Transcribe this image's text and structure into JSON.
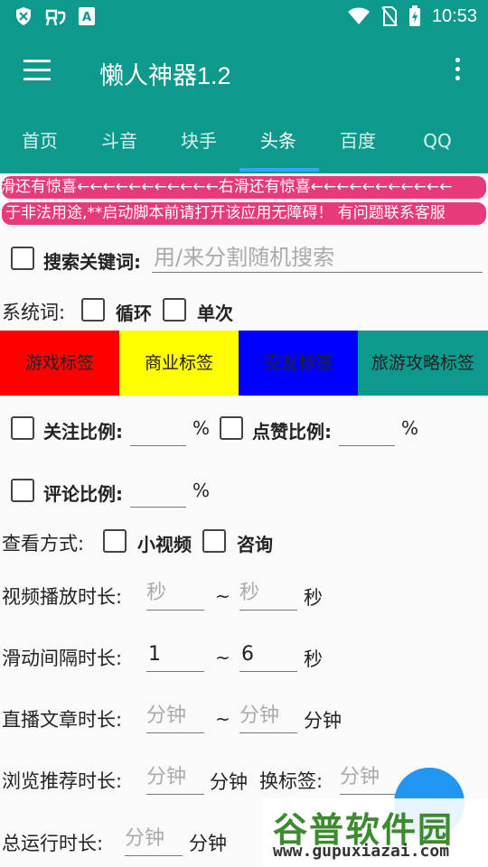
{
  "status_bar": {
    "time": "10:53",
    "left_icons": [
      "shield-icon",
      "bug-icon",
      "font-icon"
    ],
    "right_icons": [
      "wifi-icon",
      "no-sim-icon",
      "battery-charging-icon"
    ]
  },
  "app_bar": {
    "title": "懒人神器1.2"
  },
  "tabs": [
    {
      "label": "首页"
    },
    {
      "label": "斗音"
    },
    {
      "label": "块手"
    },
    {
      "label": "头条",
      "active": true
    },
    {
      "label": "百度"
    },
    {
      "label": "QQ"
    }
  ],
  "marquee": {
    "line1": "滑还有惊喜←←←←←←←←←←←右滑还有惊喜←←←←←←←←←←←",
    "line2": "于非法用途,**启动脚本前请打开该应用无障碍！ 有问题联系客服"
  },
  "search": {
    "label": "搜索关键词:",
    "placeholder": "用/来分割随机搜索"
  },
  "system_words": {
    "label": "系统词:",
    "loop_label": "循环",
    "once_label": "单次"
  },
  "tags": [
    {
      "label": "游戏标签",
      "bg": "#ff0000"
    },
    {
      "label": "商业标签",
      "bg": "#ffff00"
    },
    {
      "label": "交友标签",
      "bg": "#0000ff"
    },
    {
      "label": "旅游攻略标签",
      "bg": "#0d9a8c"
    }
  ],
  "ratios": {
    "follow_label": "关注比例:",
    "like_label": "点赞比例:",
    "comment_label": "评论比例:",
    "percent": "%"
  },
  "view_mode": {
    "label": "查看方式:",
    "short_video": "小视频",
    "consult": "咨询"
  },
  "durations": {
    "video_play_label": "视频播放时长:",
    "sec_placeholder": "秒",
    "tilde": "~",
    "sec_unit": "秒",
    "swipe_interval_label": "滑动间隔时长:",
    "swipe_min": "1",
    "swipe_max": "6",
    "live_article_label": "直播文章时长:",
    "min_placeholder": "分钟",
    "min_unit": "分钟",
    "browse_recommend_label": "浏览推荐时长:",
    "switch_tag_label": "换标签:",
    "total_run_label": "总运行时长:"
  },
  "watermark": {
    "cn": "谷普软件园",
    "url": "www.gupuxiazai.com"
  }
}
